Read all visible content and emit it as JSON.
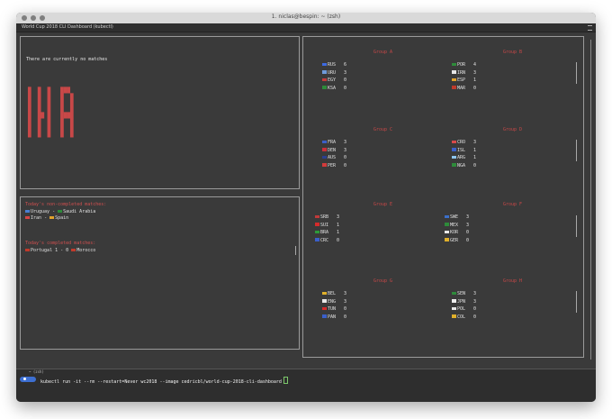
{
  "window": {
    "title": "1. niclas@bespin: ~ (zsh)"
  },
  "tab": {
    "title": "World Cup 2018 CLI Dashboard (kubectl)"
  },
  "status": {
    "no_matches": "There are currently no matches"
  },
  "big_text": "█  █  █   ███ \n█  █  █   █  █\n█  █  █   █  █\n█  █  █   █  █\n█  ██ █   ████\n█  █  █   █  █\n█  █  █   █  █\n█  █  █   █  █",
  "non_completed": {
    "title": "Today's non-completed matches:",
    "matches": [
      {
        "home": "Uruguay",
        "sep": "-",
        "away": "Saudi Arabia",
        "hf": "#4a7fd1",
        "af": "#2e8b3a"
      },
      {
        "home": "Iran",
        "sep": "-",
        "away": "Spain",
        "hf": "#d64545",
        "af": "#e0a22b"
      }
    ]
  },
  "completed": {
    "title": "Today's completed matches:",
    "matches": [
      {
        "home": "Portugal",
        "score": "1 - 0",
        "away": "Morocco",
        "hf": "#c03a2b",
        "af": "#c03a2b"
      }
    ]
  },
  "groups": [
    {
      "name": "Group A",
      "teams": [
        {
          "code": "RUS",
          "pts": "6",
          "flag": "#3d6ae0"
        },
        {
          "code": "URU",
          "pts": "3",
          "flag": "#6f9ad9"
        },
        {
          "code": "EGY",
          "pts": "0",
          "flag": "#c23b3b"
        },
        {
          "code": "KSA",
          "pts": "0",
          "flag": "#2e8b3a"
        }
      ]
    },
    {
      "name": "Group B",
      "teams": [
        {
          "code": "POR",
          "pts": "4",
          "flag": "#2e8b3a"
        },
        {
          "code": "IRN",
          "pts": "3",
          "flag": "#e5e5e5"
        },
        {
          "code": "ESP",
          "pts": "1",
          "flag": "#e0a22b"
        },
        {
          "code": "MAR",
          "pts": "0",
          "flag": "#c03a2b"
        }
      ]
    },
    {
      "name": "Group C",
      "teams": [
        {
          "code": "FRA",
          "pts": "3",
          "flag": "#3b5fc9"
        },
        {
          "code": "DEN",
          "pts": "3",
          "flag": "#c92f3a"
        },
        {
          "code": "AUS",
          "pts": "0",
          "flag": "#2b3f8f"
        },
        {
          "code": "PER",
          "pts": "0",
          "flag": "#d23b3b"
        }
      ]
    },
    {
      "name": "Group D",
      "teams": [
        {
          "code": "CRO",
          "pts": "3",
          "flag": "#d84a4a"
        },
        {
          "code": "ISL",
          "pts": "1",
          "flag": "#3b5fc9"
        },
        {
          "code": "ARG",
          "pts": "1",
          "flag": "#8ec5ee"
        },
        {
          "code": "NGA",
          "pts": "0",
          "flag": "#2e8b3a"
        }
      ]
    },
    {
      "name": "Group E",
      "teams": [
        {
          "code": "SRB",
          "pts": "3",
          "flag": "#c03a3a"
        },
        {
          "code": "SUI",
          "pts": "1",
          "flag": "#d52b2b"
        },
        {
          "code": "BRA",
          "pts": "1",
          "flag": "#2e9b3a"
        },
        {
          "code": "CRC",
          "pts": "0",
          "flag": "#3b5fc9"
        }
      ]
    },
    {
      "name": "Group F",
      "teams": [
        {
          "code": "SWE",
          "pts": "3",
          "flag": "#3b6fc9"
        },
        {
          "code": "MEX",
          "pts": "3",
          "flag": "#2e8b3a"
        },
        {
          "code": "KOR",
          "pts": "0",
          "flag": "#e8e8e8"
        },
        {
          "code": "GER",
          "pts": "0",
          "flag": "#e0b02b"
        }
      ]
    },
    {
      "name": "Group G",
      "teams": [
        {
          "code": "BEL",
          "pts": "3",
          "flag": "#e0b02b"
        },
        {
          "code": "ENG",
          "pts": "3",
          "flag": "#e8e8e8"
        },
        {
          "code": "TUN",
          "pts": "0",
          "flag": "#d52b2b"
        },
        {
          "code": "PAN",
          "pts": "0",
          "flag": "#3b5fc9"
        }
      ]
    },
    {
      "name": "Group H",
      "teams": [
        {
          "code": "SEN",
          "pts": "3",
          "flag": "#2e8b3a"
        },
        {
          "code": "JPN",
          "pts": "3",
          "flag": "#eeeeee"
        },
        {
          "code": "POL",
          "pts": "0",
          "flag": "#e8e8e8"
        },
        {
          "code": "COL",
          "pts": "0",
          "flag": "#e0b02b"
        }
      ]
    }
  ],
  "terminal": {
    "label": "~ (zsh)",
    "command": "kubectl run -it --rm --restart=Never wc2018 --image cedricbl/world-cup-2018-cli-dashboard"
  }
}
